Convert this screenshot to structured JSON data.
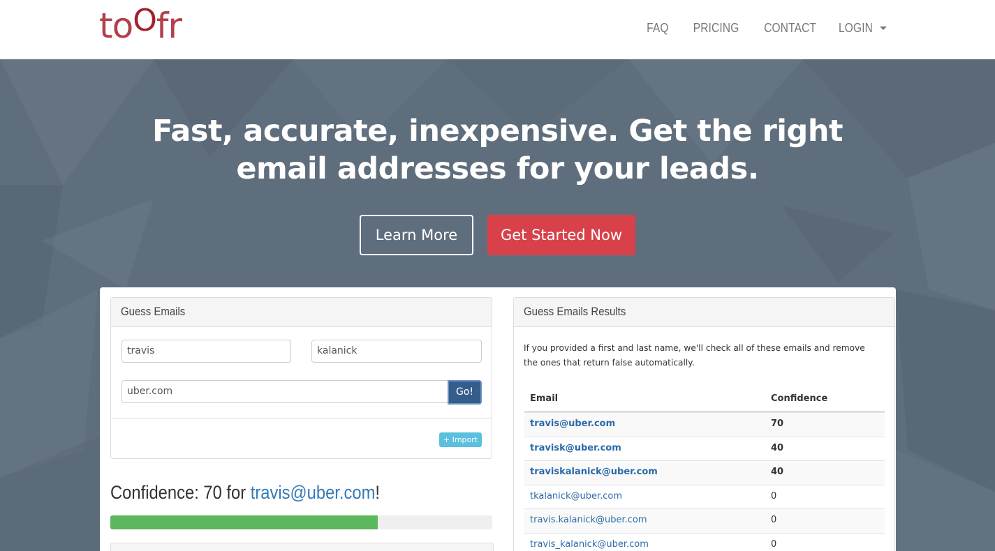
{
  "header": {
    "logo": {
      "part1": "to",
      "part2": "O",
      "part3": "fr"
    },
    "nav": [
      {
        "label": "FAQ"
      },
      {
        "label": "PRICING"
      },
      {
        "label": "CONTACT"
      },
      {
        "label": "LOGIN"
      }
    ]
  },
  "hero": {
    "headline_line1": "Fast, accurate, inexpensive. Get the right",
    "headline_line2": "email addresses for your leads.",
    "learn_more": "Learn More",
    "get_started": "Get Started Now"
  },
  "guess_panel": {
    "title": "Guess Emails",
    "first_name": "travis",
    "last_name": "kalanick",
    "domain": "uber.com",
    "go_label": "Go!",
    "import_label": "+ Import"
  },
  "confidence": {
    "prefix": "Confidence: 70 for ",
    "email": "travis@uber.com",
    "suffix": "!",
    "level_percent": 70
  },
  "results_panel": {
    "title": "Guess Emails Results",
    "description": "If you provided a first and last name, we'll check all of these emails and remove the ones that return false automatically.",
    "columns": [
      "Email",
      "Confidence"
    ],
    "rows": [
      {
        "email": "travis@uber.com",
        "confidence": "70"
      },
      {
        "email": "travisk@uber.com",
        "confidence": "40"
      },
      {
        "email": "traviskalanick@uber.com",
        "confidence": "40"
      },
      {
        "email": "tkalanick@uber.com",
        "confidence": "0"
      },
      {
        "email": "travis.kalanick@uber.com",
        "confidence": "0"
      },
      {
        "email": "travis_kalanick@uber.com",
        "confidence": "0"
      }
    ]
  },
  "colors": {
    "brand": "#b2404b",
    "hero_bg": "#5f6e7d",
    "cta": "#d9414a",
    "link": "#337ab7",
    "progress": "#5cb85c"
  }
}
